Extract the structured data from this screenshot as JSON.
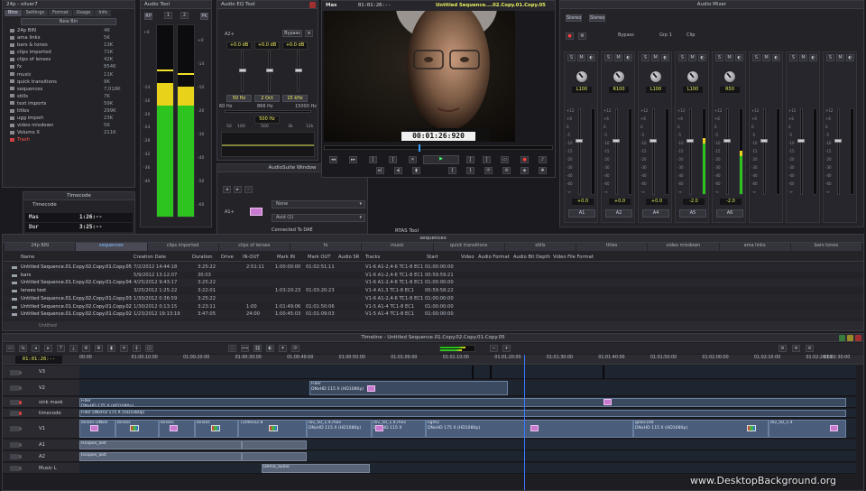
{
  "bin": {
    "title": "24p - oliver7",
    "tabs": [
      "Bins",
      "Settings",
      "Format",
      "Usage",
      "Info"
    ],
    "new_bin_label": "New Bin",
    "items": [
      {
        "name": "24p BIN",
        "size": "4K"
      },
      {
        "name": "ama links",
        "size": "5K"
      },
      {
        "name": "bars & tones",
        "size": "13K"
      },
      {
        "name": "clips imported",
        "size": "71K"
      },
      {
        "name": "clips of lenses",
        "size": "42K"
      },
      {
        "name": "fx",
        "size": "854K"
      },
      {
        "name": "music",
        "size": "11K"
      },
      {
        "name": "quick transitions",
        "size": "9K"
      },
      {
        "name": "sequences",
        "size": "7,018K"
      },
      {
        "name": "stills",
        "size": "7K"
      },
      {
        "name": "text imports",
        "size": "59K"
      },
      {
        "name": "titles",
        "size": "299K"
      },
      {
        "name": "ugg import",
        "size": "23K"
      },
      {
        "name": "video mixdown",
        "size": "5K"
      },
      {
        "name": "Volume X",
        "size": "211K"
      },
      {
        "name": "Trash",
        "size": ""
      }
    ]
  },
  "timecode": {
    "title": "Timecode",
    "label": "Timecode",
    "rows": [
      {
        "label": "Mas",
        "value": "1:26:--"
      },
      {
        "label": "Dur",
        "value": "3:25:--"
      }
    ]
  },
  "audio_tool": {
    "title": "Audio Tool",
    "btn_rp": "RP",
    "btn_pk": "PK",
    "scale_left": [
      "+0",
      "-4",
      "-8",
      "-10",
      "-12",
      "-14",
      "-16",
      "-20",
      "-24",
      "-28",
      "-32",
      "-36",
      "-40"
    ],
    "scale_right": [
      "+0",
      "-14",
      "-10",
      "-20",
      "-30",
      "-40",
      "-50",
      "-60",
      "-70"
    ],
    "levels": [
      0.68,
      0.64
    ],
    "peaks": [
      0.88,
      0.84
    ]
  },
  "audio_eq": {
    "title": "Audio EQ Tool",
    "track": "A2+",
    "bypass": "Bypass",
    "db": [
      "+0.0 dB",
      "+0.0 dB",
      "+0.0 dB"
    ],
    "bands": [
      "50 Hz",
      "2 Oct",
      "15 kHz"
    ],
    "freqs": [
      "60 Hz",
      "866 Hz",
      "15000 Hz"
    ],
    "mid_hz": "500 Hz",
    "axis": [
      "50",
      "100",
      "500",
      "3k",
      "12k"
    ]
  },
  "audiosuite": {
    "title": "AudioSuite Window",
    "track": "A1+",
    "plugin": "None",
    "target": "Avid (1)",
    "status": "Connected To DAE"
  },
  "rtas": {
    "title": "RTAS Tool"
  },
  "monitor": {
    "tc_left": "01:01:26:--",
    "label_left": "Mas",
    "seq_name": "Untitled Sequence....02.Copy.01.Copy.05",
    "timecode": "00:01:26:920"
  },
  "mixer": {
    "title": "Audio Mixer",
    "mode_label": "Stereo",
    "bypass": "Bypass",
    "grp": "Grp 1",
    "clip": "Clip",
    "pans": [
      "L100",
      "R100",
      "L100",
      "L100",
      "R50"
    ],
    "gains": [
      "+0.0",
      "+0.0",
      "+0.0",
      "-2.0",
      "-2.0"
    ],
    "tracks": [
      "A1",
      "A2",
      "A4",
      "A5",
      "A6"
    ],
    "levels": [
      0.0,
      0.0,
      0.0,
      0.6,
      0.45
    ]
  },
  "sequences_bin": {
    "title": "sequences",
    "tabs": [
      "24p BIN",
      "sequences",
      "clips imported",
      "clips of lenses",
      "fx",
      "music",
      "quick transitions",
      "stills",
      "titles",
      "video mixdown",
      "ama links",
      "bars  tones"
    ],
    "columns": [
      "Name",
      "Creation Date",
      "Duration",
      "Drive",
      "IN-OUT",
      "Mark IN",
      "Mark OUT",
      "Audio SR",
      "Tracks",
      "Start",
      "Video",
      "Audio Format",
      "Audio Bit Depth",
      "Video File Format"
    ],
    "rows": [
      {
        "name": "Untitled Sequence.01.Copy.02.Copy.01.Copy.05",
        "date": "7/2/2012 14:44:18",
        "duration": "3:25:22",
        "inout": "2:51:11",
        "markin": "1:00:00:00",
        "markout": "01:02:51:11",
        "tracks": "V1-6 A1-2,4-6 TC1-8 EC1",
        "start": "01:00:00:00"
      },
      {
        "name": "bars",
        "date": "5/9/2012 13:12:07",
        "duration": "30:03",
        "inout": "",
        "markin": "",
        "markout": "",
        "tracks": "V1-6 A1-2,4-6 TC1-8 EC1",
        "start": "00:59:59:21"
      },
      {
        "name": "Untitled Sequence.01.Copy.02.Copy.01.Copy.04",
        "date": "4/25/2012 9:43:17",
        "duration": "3:25:22",
        "inout": "",
        "markin": "",
        "markout": "",
        "tracks": "V1-6 A1-2,4-6 TC1-8 EC1",
        "start": "01:00:00:00"
      },
      {
        "name": "lenses test",
        "date": "3/25/2012 1:25:22",
        "duration": "3:22:01",
        "inout": "",
        "markin": "1:03:20:23",
        "markout": "01:03:20:23",
        "tracks": "V1-4 A1,3 TC1-8 EC1",
        "start": "00:59:58:22"
      },
      {
        "name": "Untitled Sequence.01.Copy.02.Copy.01.Copy.03",
        "date": "1/30/2012 0:36:59",
        "duration": "3:25:22",
        "inout": "",
        "markin": "",
        "markout": "",
        "tracks": "V1-6 A1-2,4-6 TC1-8 EC1",
        "start": "01:00:00:00"
      },
      {
        "name": "Untitled Sequence.01.Copy.02.Copy.01.Copy.02",
        "date": "1/30/2012 0:13:15",
        "duration": "3:23:11",
        "inout": "1:00",
        "markin": "1:01:49:06",
        "markout": "01:01:50:06",
        "tracks": "V1-5 A1-4 TC1-8 EC1",
        "start": "01:00:00:00"
      },
      {
        "name": "Untitled Sequence.01.Copy.02.Copy.01.Copy.02",
        "date": "1/23/2012 19:13:19",
        "duration": "3:47:05",
        "inout": "24:00",
        "markin": "1:00:45:03",
        "markout": "01:01:09:03",
        "tracks": "V1-5 A1-4 TC1-8 EC1",
        "start": "01:00:00:00"
      }
    ],
    "footer": "Untitled"
  },
  "timeline": {
    "title": "Timeline - Untitled Sequence.01.Copy.02.Copy.01.Copy.05",
    "tc": "01:01:26:--",
    "ruler": [
      "00:00",
      "01:00:10:00",
      "01:00:20:00",
      "01:00:30:00",
      "01:00:40:00",
      "01:00:50:00",
      "01:01:00:00",
      "01:01:10:00",
      "01:01:20:00",
      "01:01:30:00",
      "01:01:40:00",
      "01:01:50:00",
      "01:02:00:00",
      "01:02:10:00",
      "01:02:20:00",
      "01:02:30:00"
    ],
    "tracks": [
      "V3",
      "V2",
      "sink mask",
      "timecode",
      "V1",
      "A1",
      "A2",
      "Music L"
    ],
    "clips": {
      "filler_v2": "Filler",
      "filler_v2_sub": "DNxHD 115 X (HD1080p)",
      "filler_mask": "Filler",
      "filler_mask_sub": "DNxHD 175 X (HD1080p)",
      "filler_tc": "Filler DNxHD 175 X (HD1080p)",
      "v1_a": "lenses DNxH",
      "v1_b": "lenses",
      "v1_c": "lenses",
      "v1_d": "lenses",
      "v1_e": "720lens2.8",
      "v1_f": "div_50_1.4.mov",
      "v1_f_sub": "DNxHD 115 X (HD1080p)",
      "v1_g": "div_50_1.4.mov",
      "v1_g_sub": "DNxHD 115 X",
      "v1_h": "light2",
      "v1_h_sub": "DNxHD 175 X (HD1080p)",
      "v1_i": "glass100",
      "v1_i_sub": "DNxHD 115 X (HD1080p)",
      "v1_j": "div_50_1.4",
      "a1": "Iscopes_lost",
      "a2": "Iscopes_lost",
      "music": "Demo_audio"
    }
  },
  "watermark": "www.DesktopBackground.org"
}
